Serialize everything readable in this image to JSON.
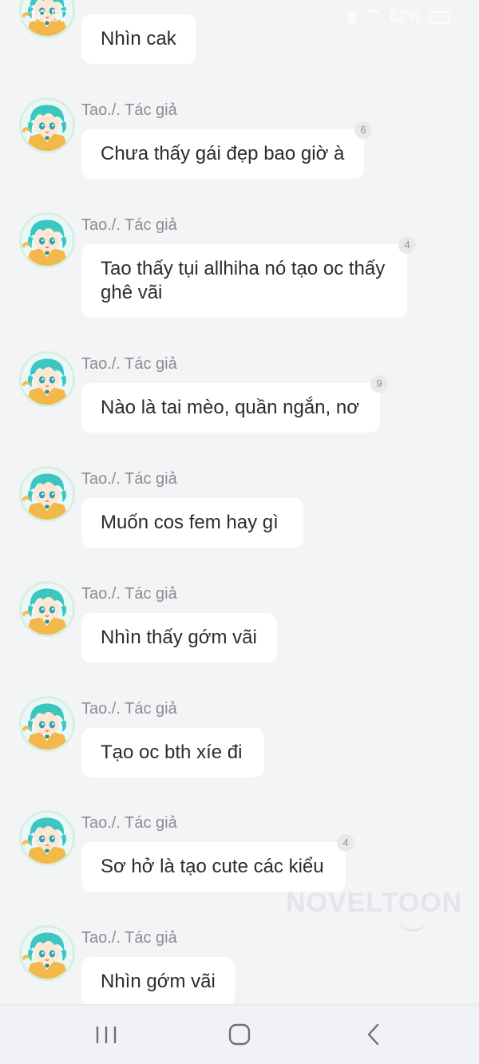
{
  "status_bar": {
    "time": "10:52",
    "battery": "62%"
  },
  "messages": [
    {
      "sender": "",
      "text": "Nhìn cak",
      "badge": ""
    },
    {
      "sender": "Tao./. Tác giả",
      "text": "Chưa thấy gái đẹp bao giờ à",
      "badge": "6"
    },
    {
      "sender": "Tao./. Tác giả",
      "text": "Tao thấy tụi allhiha nó tạo oc thấy ghê vãi",
      "badge": "4"
    },
    {
      "sender": "Tao./. Tác giả",
      "text": "Nào là tai mèo, quần ngắn, nơ",
      "badge": "9"
    },
    {
      "sender": "Tao./. Tác giả",
      "text": "Muốn cos fem hay gì",
      "badge": ""
    },
    {
      "sender": "Tao./. Tác giả",
      "text": "Nhìn thấy gớm vãi",
      "badge": ""
    },
    {
      "sender": "Tao./. Tác giả",
      "text": "Tạo oc bth xíe đi",
      "badge": ""
    },
    {
      "sender": "Tao./. Tác giả",
      "text": "Sơ hở là tạo cute các kiểu",
      "badge": "4"
    },
    {
      "sender": "Tao./. Tác giả",
      "text": "Nhìn gớm vãi",
      "badge": ""
    }
  ],
  "watermark": "NOVELTOON",
  "nav": {
    "recent_icon": "recent-apps-icon",
    "home_icon": "home-icon",
    "back_icon": "back-icon"
  }
}
